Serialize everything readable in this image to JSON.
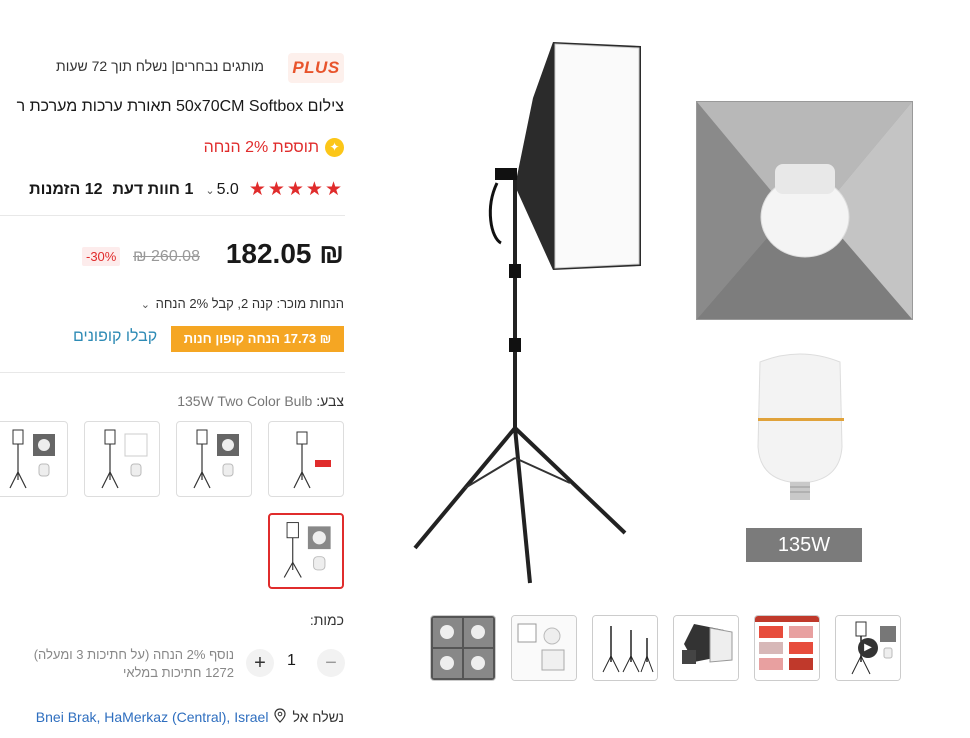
{
  "plus": {
    "badge": "PLUS",
    "text": "מותגים נבחרים| נשלח תוך 72 שעות"
  },
  "product": {
    "title": "צילום 50x70CM Softbox תאורת ערכות מערכת ר",
    "extra_discount": "תוספת 2% הנחה",
    "rating": "5.0",
    "reviews": "1 חוות דעת",
    "orders": "12 הזמנות"
  },
  "price": {
    "current": "₪ 182.05",
    "original": "₪ 260.08",
    "discount": "-30%"
  },
  "seller_discount": "הנחות מוכר: קנה 2, קבל 2% הנחה",
  "coupon": {
    "tag": "₪ 17.73 הנחה קופון חנות",
    "link": "קבלו קופונים"
  },
  "color": {
    "label": "צבע:",
    "value": "135W Two Color Bulb"
  },
  "quantity": {
    "label": "כמות:",
    "value": "1",
    "minus": "−",
    "plus": "+",
    "note_line1": "נוסף 2% הנחה (על חתיכות 3 ומעלה)",
    "note_line2": "1272 חתיכות במלאי"
  },
  "shipping": {
    "label": "נשלח אל",
    "location": "Bnei Brak, HaMerkaz (Central), Israel"
  },
  "main_image": {
    "label_135": "135W"
  },
  "icons": {
    "star": "star-icon",
    "location": "location-pin-icon",
    "play": "play-icon",
    "chevron": "chevron-down-icon"
  },
  "colors": {
    "accent_red": "#e02c2c",
    "coupon_orange": "#f5a623",
    "link_blue": "#2e8bb5"
  }
}
